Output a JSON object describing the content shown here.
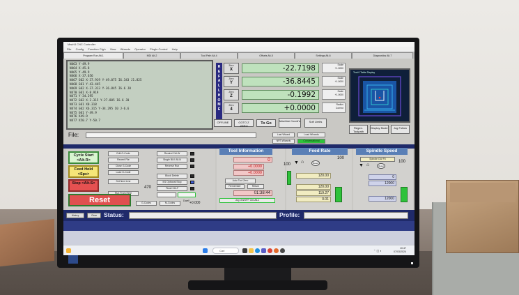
{
  "window": {
    "title": "Mach3 CNC Controller",
    "menu": [
      "File",
      "Config",
      "Function Cfg's",
      "View",
      "Wizards",
      "Operator",
      "PlugIn Control",
      "Help"
    ]
  },
  "tabs": [
    {
      "label": "Program Run Alt-1",
      "active": true
    },
    {
      "label": "MDI Alt-2",
      "active": false
    },
    {
      "label": "Tool Path Alt-4",
      "active": false
    },
    {
      "label": "Offsets Alt-5",
      "active": false
    },
    {
      "label": "Settings Alt-6",
      "active": false
    },
    {
      "label": "Diagnostics Alt-7",
      "active": false
    }
  ],
  "gcode_lines": [
    "N463 Y-49.9",
    "N464 X-45.8",
    "N465 Y-49.9",
    "N466 X-37.656",
    "N467 G02 X-37.919 Y-49.075 I6.343 J1.825",
    "N468 G01 Y-43.445",
    "N469 G02 X-37.313 Y-36.845 I6.6 J0",
    "N470 G01 X-8.919",
    "N471 Y-34.295",
    "N472 G02 X-2.315 Y-27.805 I6.6 J0",
    "N473 G01 X0.318",
    "N474 G02 X6.315 Y-34.295 I0 J-6.6",
    "N475 G01 Y-49.9",
    "N476 X49.9",
    "N477 X50.7 Y-50.7"
  ],
  "ref_all_home": "REF ALL HOME",
  "axes": [
    {
      "zero_label": "Zero",
      "axis": "X",
      "value": "-22.7198",
      "scale_label": "Scale",
      "scale": "+1.0000"
    },
    {
      "zero_label": "Zero",
      "axis": "Y",
      "value": "-36.8445",
      "scale_label": "Scale",
      "scale": "+1.0000"
    },
    {
      "zero_label": "Zero",
      "axis": "Z",
      "value": "-0.1992",
      "scale_label": "Scale",
      "scale": "+1.0000"
    },
    {
      "zero_label": "Zero",
      "axis": "4",
      "value": "+0.0000",
      "scale_label": "Radius",
      "scale": "Correct"
    }
  ],
  "dro_buttons": {
    "offline": "OFFLINE",
    "goto_zero": "GOTO Z ZERO",
    "to_go": "To Go",
    "machine_coords": "Machine Coord's",
    "soft_limits": "Soft Limits"
  },
  "toolpath": {
    "label": "Tool:0  Table Display"
  },
  "toolpath_buttons": {
    "regen": "Regen. Toolpath",
    "display_mode": "Display Mode",
    "jog_follow": "Jog Follow"
  },
  "file": {
    "label": "File:",
    "value": ""
  },
  "wizards": {
    "last": "Last Wizard",
    "nfs": "NFS Wizards",
    "load_wizards": "Load Wizards",
    "conversational": "Conversational"
  },
  "controls": {
    "cycle_start": "Cycle Start <Alt-R>",
    "feed_hold": "Feed Hold <Spc>",
    "stop": "Stop <Alt-S>",
    "reset": "Reset",
    "edit_gcode": "Edit G-Code",
    "recent_file": "Recent File",
    "close_gcode": "Close G-Code",
    "load_gcode": "Load G-Code",
    "set_next_line": "Set Next Line",
    "run_from_here": "Run From Here",
    "line_value": "470",
    "rewind": "Rewind Ctrl-W",
    "single_blk": "Single BLK Alt-N",
    "reverse_run": "Reverse Run",
    "block_delete": "Block Delete",
    "optional_stop": "M1 Optional Stop",
    "flood": "Flood Ctrl-F",
    "gcodes": "G-Codes",
    "mcodes": "M-Codes",
    "zero_value": "+0.000",
    "dwell": "Dwell"
  },
  "tool_info": {
    "title": "Tool Information",
    "tool": "0",
    "diameter": "+0.0000",
    "height": "+0.0000",
    "auto_tool_zero": "Auto Tool Zero",
    "remember": "Remember",
    "return": "Return",
    "elapsed": "01:38:44",
    "jog": "Jog ON/OFF Ctrl-Alt-J"
  },
  "feed_rate": {
    "title": "Feed Rate",
    "override_pct": "100",
    "percent": "100",
    "fro": "120.00",
    "feedrate": "120.00",
    "units_min": "119.27",
    "units_rev": "0.01",
    "reset": "Reset"
  },
  "spindle": {
    "title": "Spindle Speed",
    "cw": "Spindle CW F5",
    "override_pct": "100",
    "sro": "0",
    "rpm": "12000",
    "spindle_speed": "12000",
    "reset": "Reset"
  },
  "status": {
    "label": "Status:",
    "value": "",
    "history": "History",
    "clear": "Clear",
    "profile_label": "Profile:",
    "profile_value": ""
  },
  "taskbar": {
    "search": "Cari",
    "time": "10:47",
    "date": "07/03/2024"
  },
  "colors": {
    "navy": "#1f2a6a",
    "dro_green": "#bfe2bd",
    "reset_red": "#e05050",
    "panel_title_blue": "#5a7fb6"
  }
}
